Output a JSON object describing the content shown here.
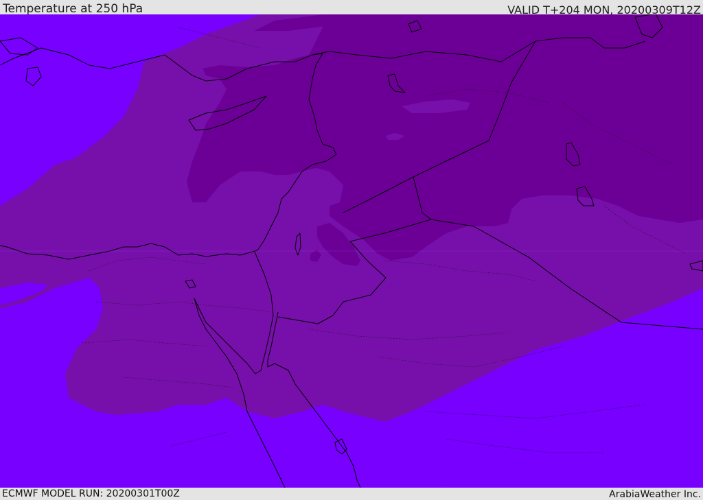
{
  "header": {
    "title": "Temperature at 250 hPa",
    "valid_time": "VALID T+204 MON, 20200309T12Z"
  },
  "footer": {
    "model_run": "ECMWF MODEL RUN: 20200301T00Z",
    "provider": "ArabiaWeather Inc."
  },
  "map": {
    "field": "temperature",
    "level": "250 hPa",
    "colors": {
      "coolest": "#6c0096",
      "cool": "#7710ab",
      "mid": "#7c00d8",
      "warm": "#7700ff",
      "coast": "#000000"
    }
  }
}
